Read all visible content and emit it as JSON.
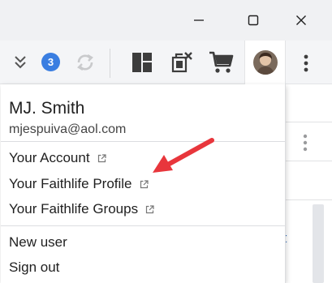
{
  "titlebar": {
    "minimize_icon": "minimize-icon",
    "maximize_icon": "maximize-icon",
    "close_icon": "close-icon"
  },
  "toolbar": {
    "collapse_icon": "double-chevron-down-icon",
    "notification_count": "3",
    "accent_color": "#3a7ee1",
    "sync_icon": "sync-icon",
    "layout_icon": "layout-icon",
    "windows_icon": "close-windows-icon",
    "cart_icon": "cart-icon",
    "avatar": "user-avatar",
    "more_icon": "more-vertical-icon"
  },
  "account_menu": {
    "name": "MJ. Smith",
    "email": "mjespuiva@aol.com",
    "links": [
      {
        "label": "Your Account",
        "icon": "external-link-icon"
      },
      {
        "label": "Your Faithlife Profile",
        "icon": "external-link-icon"
      },
      {
        "label": "Your Faithlife Groups",
        "icon": "external-link-icon"
      }
    ],
    "actions": [
      {
        "label": "New user"
      },
      {
        "label": "Sign out"
      }
    ]
  },
  "background": {
    "link_fragment": "rt"
  },
  "annotation": {
    "arrow_color": "#e8363c",
    "points_to": "Your Faithlife Profile"
  }
}
